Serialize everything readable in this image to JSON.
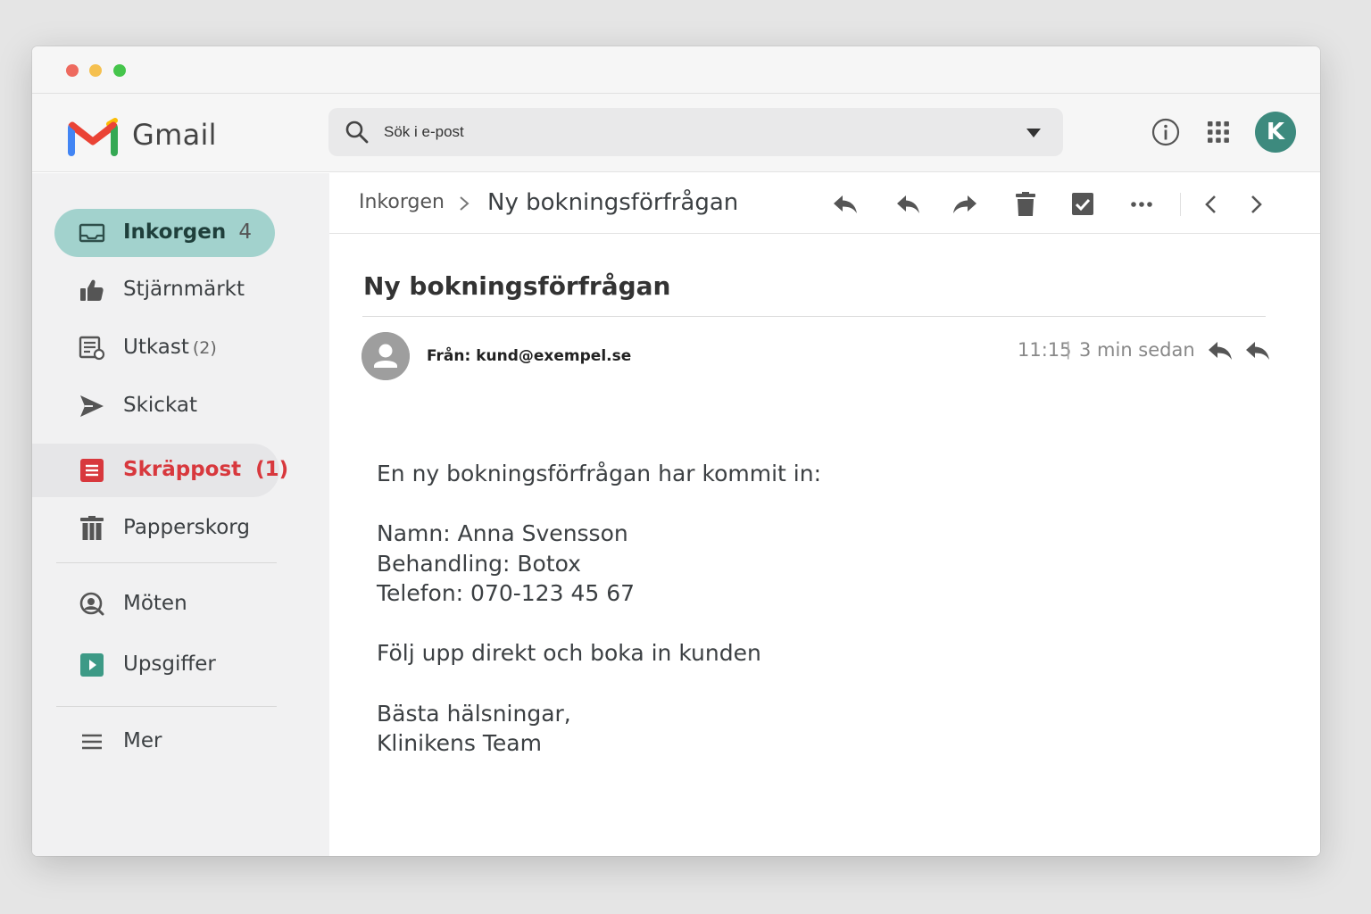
{
  "app": {
    "brand": "Gmail"
  },
  "search": {
    "placeholder": "Sök i e-post"
  },
  "account": {
    "initial": "K"
  },
  "sidebar": {
    "items": [
      {
        "label": "Inkorgen",
        "count": "4"
      },
      {
        "label": "Stjärnmärkt"
      },
      {
        "label": "Utkast",
        "count": "(2)"
      },
      {
        "label": "Skickat"
      },
      {
        "label": "Skräppost",
        "count": "(1)"
      },
      {
        "label": "Papperskorg"
      },
      {
        "label": "Möten"
      },
      {
        "label": "Upsgiffer"
      },
      {
        "label": "Mer"
      }
    ]
  },
  "breadcrumb": {
    "root": "Inkorgen",
    "current": "Ny bokningsförfrågan"
  },
  "email": {
    "subject": "Ny bokningsförfrågan",
    "from": "Från: kund@exempel.se",
    "time": "11:15",
    "separator": "|",
    "ago": "3 min sedan",
    "body": [
      "En ny bokningsförfrågan har kommit in:",
      "Namn: Anna Svensson",
      "Behandling: Botox",
      "Telefon: 070-123 45 67",
      "Följ upp direkt och boka in kunden",
      "Bästa hälsningar,",
      "Klinikens Team"
    ]
  },
  "colors": {
    "accent": "#3d8a7e",
    "active_nav": "#a2d2cd",
    "spam_red": "#d8383d",
    "gmail_red": "#ea4335",
    "gmail_blue": "#4285f4",
    "gmail_green": "#34a853",
    "gmail_yellow": "#fbbc04"
  }
}
